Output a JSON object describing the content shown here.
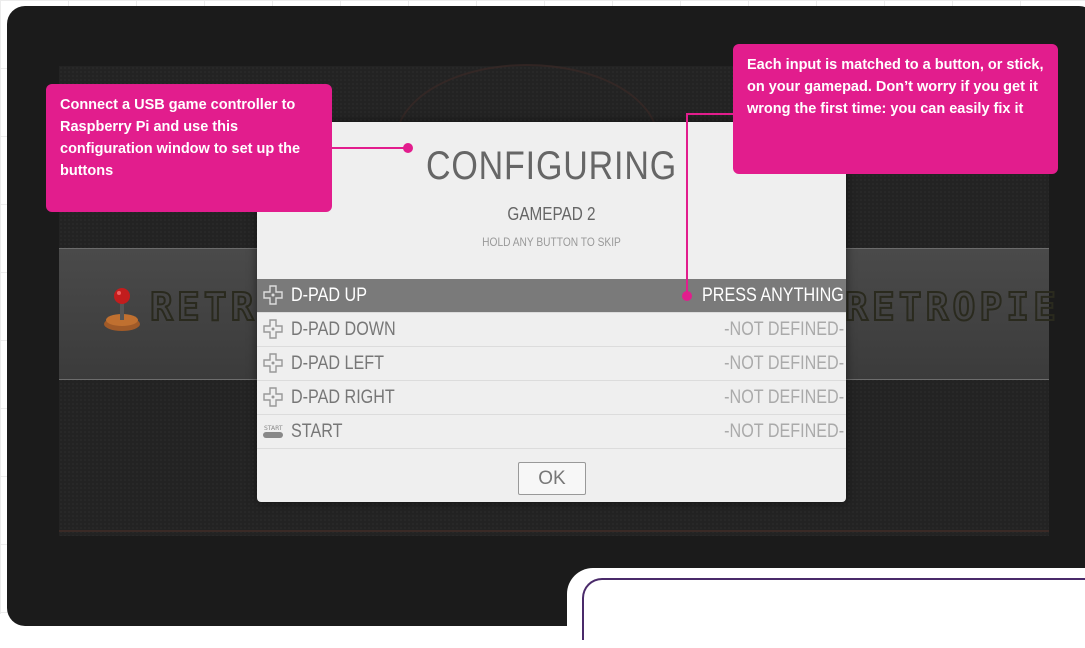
{
  "dialog": {
    "title": "CONFIGURING",
    "subtitle": "GAMEPAD 2",
    "hint": "HOLD ANY BUTTON TO SKIP",
    "rows": [
      {
        "name": "D-PAD UP",
        "value": "PRESS ANYTHING",
        "icon": "dpad-icon",
        "active": true
      },
      {
        "name": "D-PAD DOWN",
        "value": "-NOT DEFINED-",
        "icon": "dpad-icon",
        "active": false
      },
      {
        "name": "D-PAD LEFT",
        "value": "-NOT DEFINED-",
        "icon": "dpad-icon",
        "active": false
      },
      {
        "name": "D-PAD RIGHT",
        "value": "-NOT DEFINED-",
        "icon": "dpad-icon",
        "active": false
      },
      {
        "name": "START",
        "value": "-NOT DEFINED-",
        "icon": "start-button-icon",
        "active": false
      }
    ],
    "ok_label": "OK"
  },
  "callouts": {
    "left": "Connect a USB game controller to Raspberry Pi and use this configuration window to set up the buttons",
    "right": "Each input is matched to a button, or stick, on your gamepad. Don’t worry if you get it wrong the first time: you can easily fix it"
  },
  "colors": {
    "accent": "#e21d8d",
    "dialog_bg": "#efefef",
    "active_row": "#7a7a7a",
    "screen_bg": "#1b1b1b"
  }
}
